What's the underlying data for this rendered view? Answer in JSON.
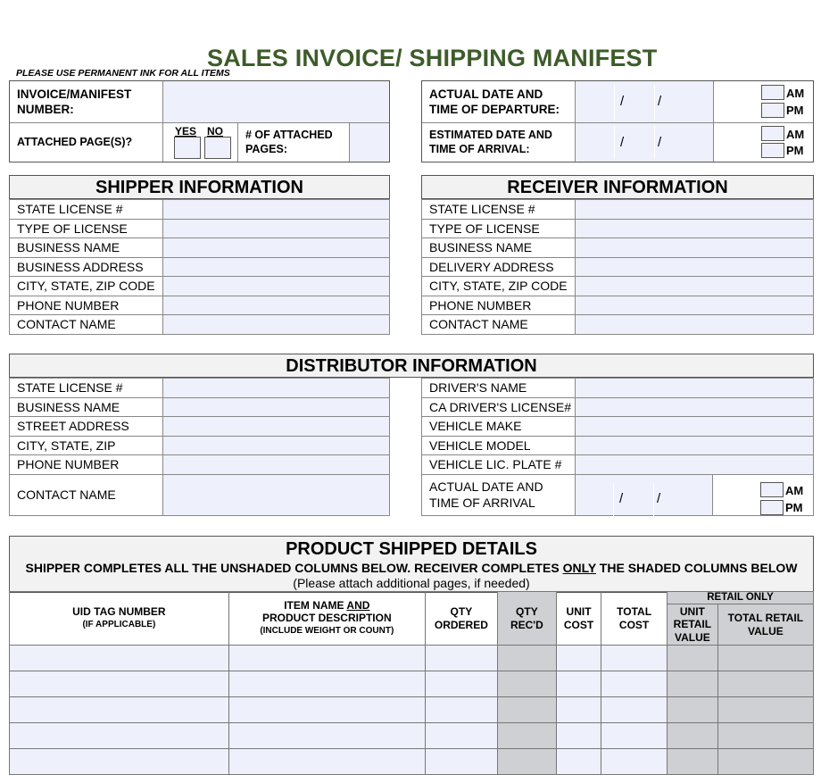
{
  "title": "SALES INVOICE/ SHIPPING MANIFEST",
  "note": "PLEASE USE PERMANENT INK FOR ALL ITEMS",
  "top_left": {
    "invoice_label": "INVOICE/MANIFEST NUMBER:",
    "attached_label": "ATTACHED PAGE(S)?",
    "yes": "YES",
    "no": "NO",
    "num_attached_label": "# OF ATTACHED PAGES:"
  },
  "top_right": {
    "departure_label": "ACTUAL DATE AND TIME OF DEPARTURE:",
    "arrival_label": "ESTIMATED DATE AND TIME OF ARRIVAL:",
    "slash": "/",
    "am": "AM",
    "pm": "PM"
  },
  "shipper": {
    "header": "SHIPPER INFORMATION",
    "rows": [
      "STATE LICENSE #",
      "TYPE OF LICENSE",
      "BUSINESS NAME",
      "BUSINESS ADDRESS",
      "CITY, STATE, ZIP CODE",
      "PHONE NUMBER",
      "CONTACT NAME"
    ]
  },
  "receiver": {
    "header": "RECEIVER INFORMATION",
    "rows": [
      "STATE LICENSE #",
      "TYPE OF LICENSE",
      "BUSINESS NAME",
      "DELIVERY ADDRESS",
      "CITY, STATE, ZIP CODE",
      "PHONE NUMBER",
      "CONTACT NAME"
    ]
  },
  "distributor": {
    "header": "DISTRIBUTOR INFORMATION",
    "left_rows": [
      "STATE LICENSE #",
      "BUSINESS NAME",
      "STREET ADDRESS",
      "CITY, STATE, ZIP",
      "PHONE NUMBER",
      "CONTACT NAME"
    ],
    "right_rows": [
      "DRIVER'S NAME",
      "CA DRIVER'S LICENSE#",
      "VEHICLE MAKE",
      "VEHICLE MODEL",
      "VEHICLE LIC. PLATE #"
    ],
    "arrival_label": "ACTUAL DATE AND TIME OF ARRIVAL"
  },
  "product": {
    "header": "PRODUCT SHIPPED DETAILS",
    "instructions_pre": "SHIPPER COMPLETES ALL THE UNSHADED COLUMNS BELOW.  RECEIVER COMPLETES ",
    "instructions_only": "ONLY",
    "instructions_post": " THE SHADED COLUMNS BELOW",
    "attach_note": "(Please attach additional pages, if needed)",
    "retail_only": "RETAIL ONLY",
    "col_uid": "UID TAG NUMBER",
    "col_uid_sub": "(IF APPLICABLE)",
    "col_item_a": "ITEM NAME ",
    "col_item_and": "AND",
    "col_item_b": "PRODUCT DESCRIPTION",
    "col_item_sub": "(INCLUDE WEIGHT OR COUNT)",
    "col_qty_ordered": "QTY ORDERED",
    "col_qty_recd": "QTY REC'D",
    "col_unit_cost": "UNIT COST",
    "col_total_cost": "TOTAL COST",
    "col_unit_retail": "UNIT RETAIL VALUE",
    "col_total_retail": "TOTAL RETAIL VALUE"
  }
}
